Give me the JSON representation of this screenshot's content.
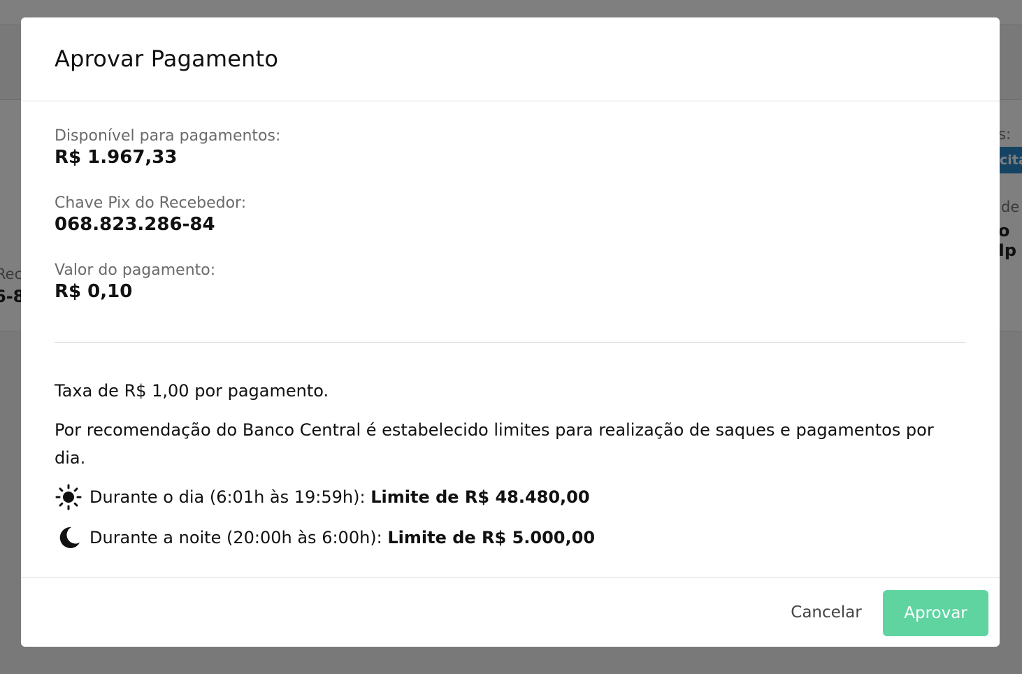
{
  "background": {
    "left_label": "Rec",
    "left_value": "6-8",
    "right_label": "s:",
    "right_badge": "cita",
    "right_label2": "de",
    "right_value2": "o Ip"
  },
  "modal": {
    "title": "Aprovar Pagamento",
    "fields": [
      {
        "label": "Disponível para pagamentos:",
        "value": "R$ 1.967,33"
      },
      {
        "label": "Chave Pix do Recebedor:",
        "value": "068.823.286-84"
      },
      {
        "label": "Valor do pagamento:",
        "value": "R$ 0,10"
      }
    ],
    "fee_text": "Taxa de R$ 1,00 por pagamento.",
    "recommendation_text": "Por recomendação do Banco Central é estabelecido limites para realização de saques e pagamentos por dia.",
    "limits": [
      {
        "icon": "sun-icon",
        "period": "Durante o dia (6:01h às 19:59h): ",
        "limit": "Limite de R$ 48.480,00"
      },
      {
        "icon": "moon-icon",
        "period": "Durante a noite (20:00h às 6:00h): ",
        "limit": "Limite de R$ 5.000,00"
      }
    ],
    "cancel_label": "Cancelar",
    "approve_label": "Aprovar",
    "colors": {
      "approve": "#5fd4a1",
      "overlay": "rgba(0,0,0,0.5)"
    }
  }
}
